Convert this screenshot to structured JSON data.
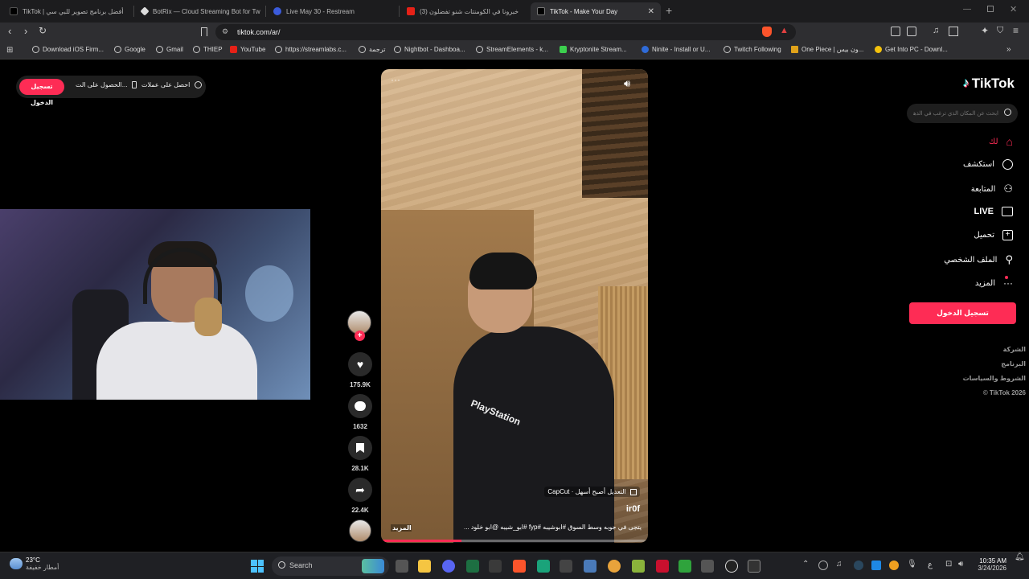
{
  "tabs": [
    {
      "label": "TikTok | أفضل برنامج تصوير للبي سي"
    },
    {
      "label": "BotRix — Cloud Streaming Bot for Tw"
    },
    {
      "label": "Live May 30 - Restream"
    },
    {
      "label": "(3) خبرونا في الكومنتات شنو تفضلون"
    },
    {
      "label": "TikTok - Make Your Day"
    }
  ],
  "address": {
    "url": "tiktok.com/ar/"
  },
  "bookmarks": [
    {
      "label": "Download iOS Firm..."
    },
    {
      "label": "Google"
    },
    {
      "label": "Gmail"
    },
    {
      "label": "THIEP"
    },
    {
      "label": "YouTube"
    },
    {
      "label": "https://streamlabs.c..."
    },
    {
      "label": "ترجمة"
    },
    {
      "label": "Nightbot - Dashboa..."
    },
    {
      "label": "StreamElements - k..."
    },
    {
      "label": "Kryptonite Stream..."
    },
    {
      "label": "Ninite - Install or U..."
    },
    {
      "label": "Twitch Following"
    },
    {
      "label": "One Piece | ون بيس..."
    },
    {
      "label": "Get Into PC - Downl..."
    }
  ],
  "top_left": {
    "login_label": "تسجيل الدخول",
    "get_app_label": "الحصول على الت...",
    "get_coins_label": "احصل على عملات"
  },
  "brand": {
    "logo_text": "TikTok",
    "accent": "#fe2c55"
  },
  "search": {
    "placeholder": "ابحث عن المكان الذي ترغب في الذهاب إليه"
  },
  "nav": [
    {
      "label": "لك",
      "icon": "home-icon"
    },
    {
      "label": "استكشف",
      "icon": "compass-icon"
    },
    {
      "label": "المتابعة",
      "icon": "user-plus-icon"
    },
    {
      "label": "LIVE",
      "icon": "live-tv-icon"
    },
    {
      "label": "تحميل",
      "icon": "upload-icon"
    },
    {
      "label": "الملف الشخصي",
      "icon": "profile-icon"
    },
    {
      "label": "المزيد",
      "icon": "more-icon"
    }
  ],
  "sidebar_login_label": "تسجيل الدخول",
  "footer_links": [
    "الشركة",
    "البرنامج",
    "الشروط والسياسات",
    "© TikTok 2026"
  ],
  "video": {
    "capcut_label": "CapCut · التعديل أصبح أسهل",
    "author": "ir0f",
    "caption": "يتجى في جوبه وسط السوق #ابوشيبه #fyp #ابو_شيبه @ابو خلود ...",
    "more_label": "المزيد",
    "progress": 0.3
  },
  "actions": {
    "likes": "175.9K",
    "comments": "1632",
    "saves": "28.1K",
    "shares": "22.4K"
  },
  "taskbar": {
    "weather_temp": "23°C",
    "weather_desc": "أمطار خفيفة",
    "search_label": "Search",
    "time": "10:35 AM",
    "date": "3/24/2026",
    "lang": "ع"
  }
}
